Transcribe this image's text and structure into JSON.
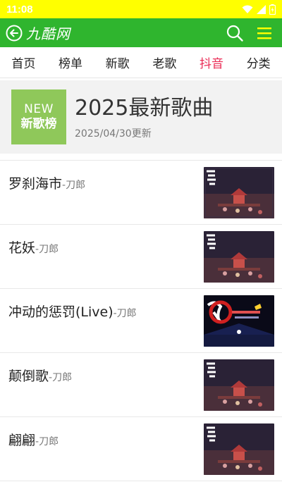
{
  "status_bar": {
    "time": "11:08"
  },
  "header": {
    "title": "九酷网"
  },
  "nav": {
    "tabs": [
      {
        "label": "首页",
        "active": false
      },
      {
        "label": "榜单",
        "active": false
      },
      {
        "label": "新歌",
        "active": false
      },
      {
        "label": "老歌",
        "active": false
      },
      {
        "label": "抖音",
        "active": true
      },
      {
        "label": "分类",
        "active": false
      }
    ]
  },
  "banner": {
    "badge_top": "NEW",
    "badge_bottom": "新歌榜",
    "title": "2025最新歌曲",
    "date": "2025/04/30更新"
  },
  "songs": [
    {
      "title": "罗刹海市",
      "artist": "-刀郎",
      "cover": "album-cover-shange"
    },
    {
      "title": "花妖",
      "artist": "-刀郎",
      "cover": "album-cover-shange"
    },
    {
      "title": "冲动的惩罚(Live)",
      "artist": "-刀郎",
      "cover": "album-cover-concert"
    },
    {
      "title": "颠倒歌",
      "artist": "-刀郎",
      "cover": "album-cover-shange"
    },
    {
      "title": "翩翩",
      "artist": "-刀郎",
      "cover": "album-cover-shange"
    }
  ],
  "colors": {
    "status_bar": "#ffff00",
    "header": "#2fb52e",
    "active_tab": "#ea2b55",
    "badge": "#8fc85a"
  }
}
